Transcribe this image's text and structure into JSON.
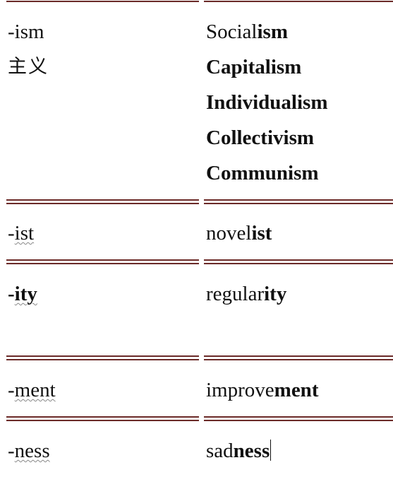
{
  "rows": [
    {
      "suffix": "-ism",
      "chinese": "主义",
      "examples": [
        {
          "plain": "Social",
          "bold": "ism"
        },
        {
          "plain": "",
          "bold": "Capitalism"
        },
        {
          "plain": "",
          "bold": "Individualism"
        },
        {
          "plain": "",
          "bold": "Collectivism"
        },
        {
          "plain": "",
          "bold": "Communism"
        }
      ]
    },
    {
      "prefix": "-",
      "stem": "ist",
      "example_plain": "novel",
      "example_bold": "ist"
    },
    {
      "prefix": "-",
      "stem": "ity",
      "example_plain": "regular",
      "example_bold": "ity"
    },
    {
      "prefix": "-",
      "stem": "ment",
      "example_plain": "improve",
      "example_bold": "ment"
    },
    {
      "prefix": "-",
      "stem": "ness",
      "example_plain": "sad",
      "example_bold": "ness"
    }
  ],
  "colors": {
    "rule": "#6b2a28",
    "text": "#111111"
  }
}
